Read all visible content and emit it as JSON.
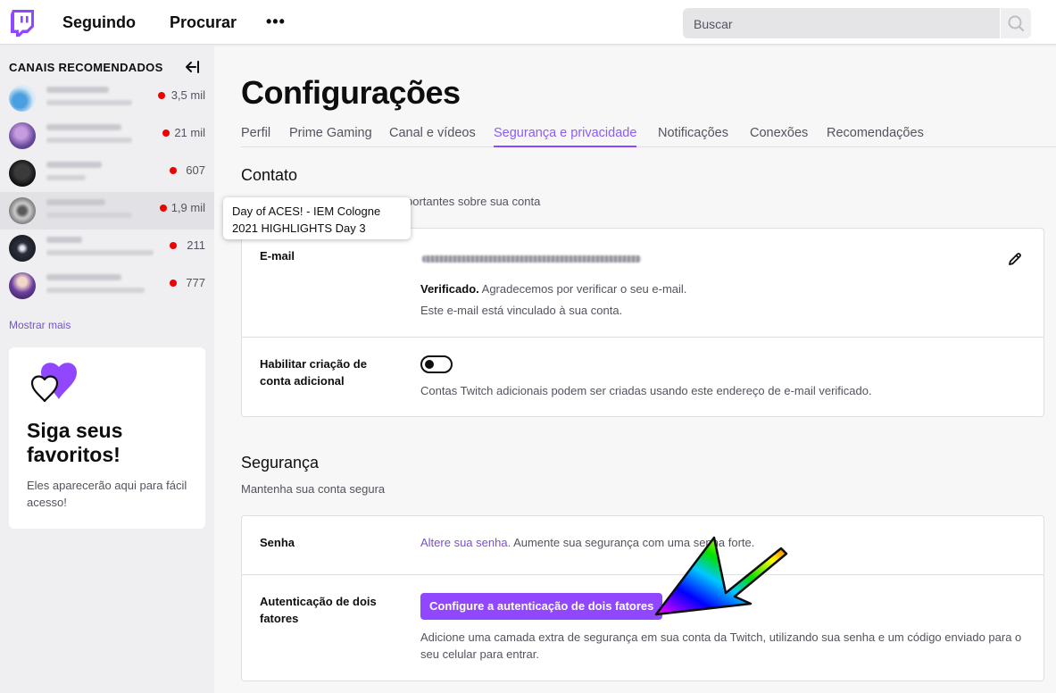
{
  "topnav": {
    "following_label": "Seguindo",
    "browse_label": "Procurar",
    "more_label": "•••",
    "search_placeholder": "Buscar"
  },
  "sidebar": {
    "heading": "CANAIS RECOMENDADOS",
    "channels": [
      {
        "viewers": "3,5 mil",
        "live": true
      },
      {
        "viewers": "21 mil",
        "live": true
      },
      {
        "viewers": "607",
        "live": true
      },
      {
        "viewers": "1,9 mil",
        "live": true
      },
      {
        "viewers": "211",
        "live": true
      },
      {
        "viewers": "777",
        "live": true
      }
    ],
    "show_more": "Mostrar mais",
    "promo": {
      "title": "Siga seus favoritos!",
      "text": "Eles aparecerão aqui para fácil acesso!"
    }
  },
  "tooltip": {
    "text": "Day of ACES! - IEM Cologne 2021 HIGHLIGHTS Day 3"
  },
  "main": {
    "title": "Configurações",
    "tabs": [
      {
        "label": "Perfil",
        "active": false
      },
      {
        "label": "Prime Gaming",
        "active": false
      },
      {
        "label": "Canal e vídeos",
        "active": false
      },
      {
        "label": "Segurança e privacidade",
        "active": true
      },
      {
        "label": "Notificações",
        "active": false
      },
      {
        "label": "Conexões",
        "active": false
      },
      {
        "label": "Recomendações",
        "active": false
      }
    ],
    "contact": {
      "title": "Contato",
      "subtitle_visible": "portantes sobre sua conta",
      "email_label": "E-mail",
      "verified_bold": "Verificado.",
      "verified_text": " Agradecemos por verificar o seu e-mail.",
      "linked_text": "Este e-mail está vinculado à sua conta.",
      "additional_label": "Habilitar criação de conta adicional",
      "additional_toggle_on": false,
      "additional_desc": "Contas Twitch adicionais podem ser criadas usando este endereço de e-mail verificado."
    },
    "security": {
      "title": "Segurança",
      "subtitle": "Mantenha sua conta segura",
      "password_label": "Senha",
      "password_link": "Altere sua senha.",
      "password_text": " Aumente sua segurança com uma senha forte.",
      "twofa_label": "Autenticação de dois fatores",
      "twofa_button": "Configure a autenticação de dois fatores",
      "twofa_desc": "Adicione uma camada extra de segurança em sua conta da Twitch, utilizando sua senha e um código enviado para o seu celular para entrar."
    }
  },
  "colors": {
    "accent": "#9147ff",
    "link": "#7952c8",
    "live": "#eb0400"
  },
  "icons": {
    "logo": "twitch-logo-icon",
    "search": "search-icon",
    "collapse": "arrow-collapse-left-icon",
    "pencil": "pencil-icon",
    "hearts": "hearts-icon",
    "annotation_arrow": "rainbow-arrow-icon"
  }
}
